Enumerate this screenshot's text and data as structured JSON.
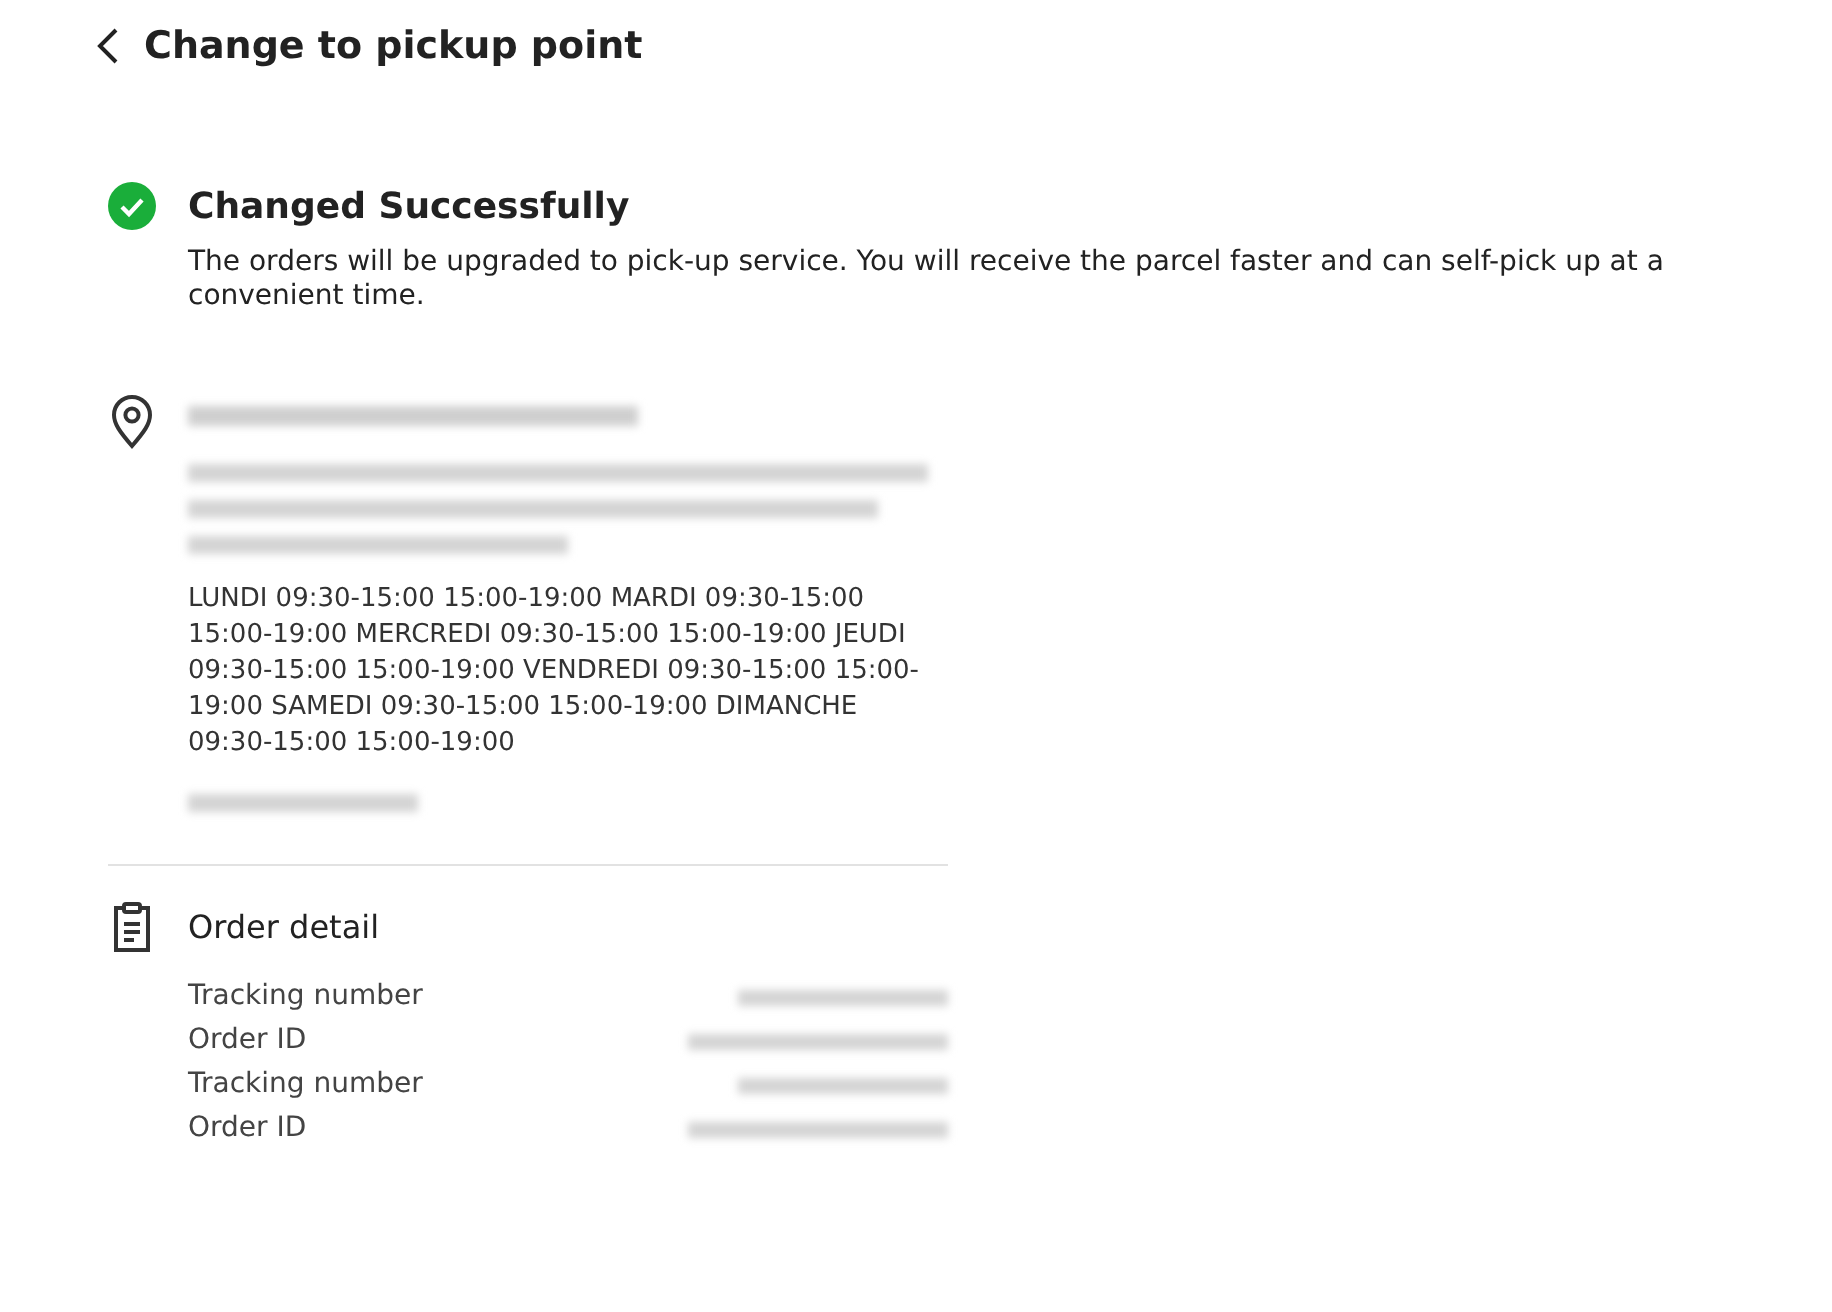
{
  "header": {
    "title": "Change to pickup point"
  },
  "result": {
    "title": "Changed Successfully",
    "message": "The orders will be upgraded to pick-up service. You will receive the parcel faster and can self-pick up at a convenient time."
  },
  "pickup_point": {
    "hours": "LUNDI 09:30-15:00 15:00-19:00 MARDI 09:30-15:00 15:00-19:00 MERCREDI 09:30-15:00 15:00-19:00 JEUDI 09:30-15:00 15:00-19:00 VENDREDI 09:30-15:00 15:00-19:00 SAMEDI 09:30-15:00 15:00-19:00 DIMANCHE 09:30-15:00 15:00-19:00"
  },
  "order_detail": {
    "title": "Order detail",
    "rows": [
      {
        "label": "Tracking number"
      },
      {
        "label": "Order ID"
      },
      {
        "label": "Tracking number"
      },
      {
        "label": "Order ID"
      }
    ]
  }
}
